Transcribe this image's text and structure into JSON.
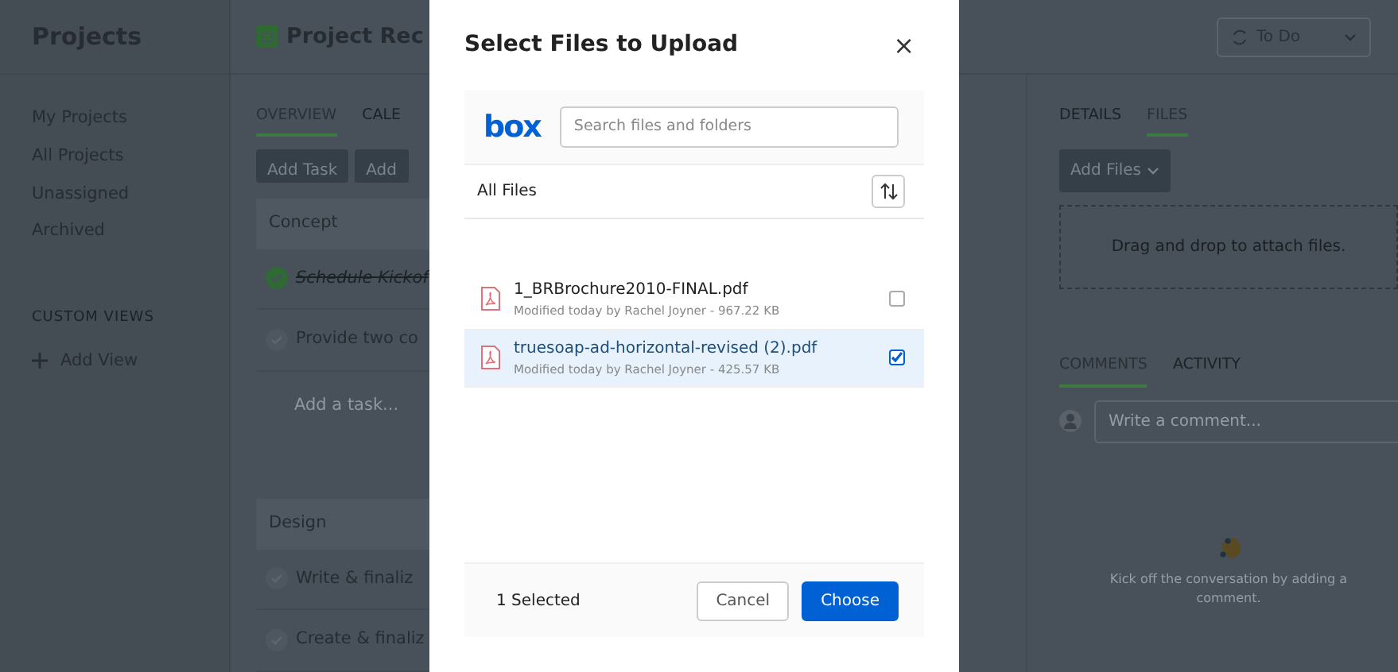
{
  "sidebar": {
    "title": "Projects",
    "items": [
      {
        "label": "My Projects"
      },
      {
        "label": "All Projects"
      },
      {
        "label": "Unassigned"
      },
      {
        "label": "Archived"
      }
    ],
    "section_label": "CUSTOM VIEWS",
    "add_view": "Add View"
  },
  "project": {
    "title": "Project Rec",
    "tabs": [
      {
        "label": "OVERVIEW",
        "selected": true
      },
      {
        "label": "CALE",
        "selected": false
      }
    ],
    "buttons": [
      "Add Task",
      "Add"
    ],
    "sections": [
      {
        "name": "Concept",
        "tasks": [
          {
            "label": "Schedule Kickof",
            "done": true
          },
          {
            "label": "Provide two co",
            "done": false
          }
        ],
        "add_placeholder": "Add a task..."
      },
      {
        "name": "Design",
        "tasks": [
          {
            "label": "Write & finaliz",
            "done": false
          },
          {
            "label": "Create & finaliz",
            "done": false
          }
        ]
      }
    ]
  },
  "details": {
    "status": "To Do",
    "tabs": [
      {
        "label": "DETAILS",
        "selected": false
      },
      {
        "label": "FILES",
        "selected": true
      }
    ],
    "add_files": "Add Files",
    "dropzone": "Drag and drop to attach files.",
    "comment_tabs": [
      {
        "label": "COMMENTS",
        "selected": true
      },
      {
        "label": "ACTIVITY",
        "selected": false
      }
    ],
    "comment_placeholder": "Write a comment...",
    "empty_text": "Kick off the conversation by adding a comment."
  },
  "dialog": {
    "title": "Select Files to Upload",
    "close": "×",
    "logo": "box",
    "search_placeholder": "Search files and folders",
    "folder": "All Files",
    "files": [
      {
        "name": "1_BRBrochure2010-FINAL.pdf",
        "meta": "Modified today by Rachel Joyner - 967.22 KB",
        "selected": false
      },
      {
        "name": "truesoap-ad-horizontal-revised (2).pdf",
        "meta": "Modified today by Rachel Joyner - 425.57 KB",
        "selected": true
      }
    ],
    "selection_count": "1 Selected",
    "buttons": [
      {
        "label": "Cancel",
        "kind": "secondary"
      },
      {
        "label": "Choose",
        "kind": "primary"
      }
    ]
  }
}
